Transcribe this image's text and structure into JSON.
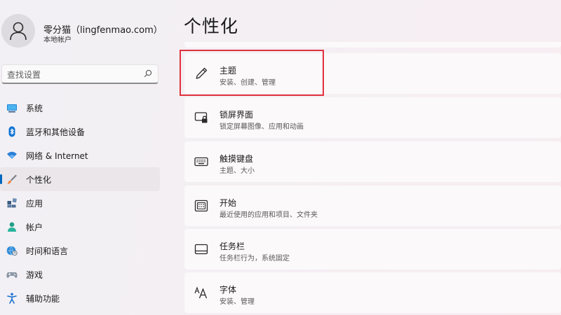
{
  "user": {
    "name": "零分猫（lingfenmao.com）",
    "account_type": "本地帐户"
  },
  "search": {
    "placeholder": "查找设置"
  },
  "nav": {
    "items": [
      {
        "label": "系统",
        "icon": "display-icon"
      },
      {
        "label": "蓝牙和其他设备",
        "icon": "bluetooth-icon"
      },
      {
        "label": "网络 & Internet",
        "icon": "wifi-icon"
      },
      {
        "label": "个性化",
        "icon": "brush-icon",
        "selected": true
      },
      {
        "label": "应用",
        "icon": "apps-icon"
      },
      {
        "label": "帐户",
        "icon": "person-icon"
      },
      {
        "label": "时间和语言",
        "icon": "globe-clock-icon"
      },
      {
        "label": "游戏",
        "icon": "gamepad-icon"
      },
      {
        "label": "辅助功能",
        "icon": "accessibility-icon"
      }
    ]
  },
  "main": {
    "title": "个性化",
    "cards": [
      {
        "title": "主题",
        "subtitle": "安装、创建、管理",
        "icon": "pen-icon"
      },
      {
        "title": "锁屏界面",
        "subtitle": "锁定屏幕图像、应用和动画",
        "icon": "lock-screen-icon"
      },
      {
        "title": "触摸键盘",
        "subtitle": "主题、大小",
        "icon": "keyboard-icon"
      },
      {
        "title": "开始",
        "subtitle": "最近使用的应用和项目、文件夹",
        "icon": "start-menu-icon"
      },
      {
        "title": "任务栏",
        "subtitle": "任务栏行为，系统固定",
        "icon": "taskbar-icon"
      },
      {
        "title": "字体",
        "subtitle": "安装、管理",
        "icon": "font-icon"
      }
    ]
  },
  "colors": {
    "accent": "#0067c0",
    "highlight_box": "#e0323e"
  }
}
